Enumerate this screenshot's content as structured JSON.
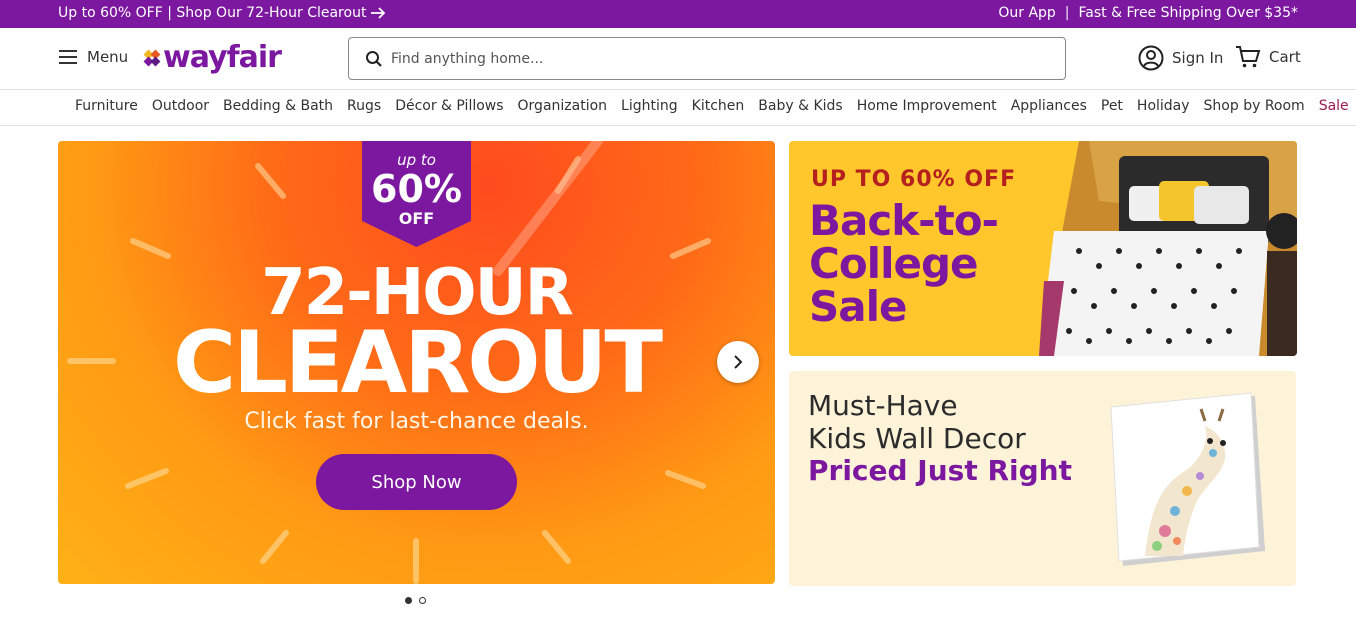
{
  "promo_bar": {
    "left_text": "Up to 60% OFF | Shop Our 72-Hour Clearout",
    "app_link": "Our App",
    "shipping_text": "Fast & Free Shipping Over $35*"
  },
  "header": {
    "menu_label": "Menu",
    "logo_text": "wayfair",
    "search_placeholder": "Find anything home...",
    "signin_label": "Sign In",
    "cart_label": "Cart"
  },
  "categories": [
    "Furniture",
    "Outdoor",
    "Bedding & Bath",
    "Rugs",
    "Décor & Pillows",
    "Organization",
    "Lighting",
    "Kitchen",
    "Baby & Kids",
    "Home Improvement",
    "Appliances",
    "Pet",
    "Holiday",
    "Shop by Room",
    "Sale"
  ],
  "hero": {
    "badge_upto": "up to",
    "badge_percent": "60%",
    "badge_off": "OFF",
    "title_line1": "72-HOUR",
    "title_line2": "CLEAROUT",
    "subtitle": "Click fast for last-chance deals.",
    "cta_label": "Shop Now",
    "slide_count": 2,
    "active_slide": 1
  },
  "promo_cards": [
    {
      "kicker": "UP TO 60% OFF",
      "title_lines": [
        "Back-to-",
        "College",
        "Sale"
      ]
    },
    {
      "line1": "Must-Have",
      "line2": "Kids Wall Decor",
      "line3": "Priced Just Right"
    }
  ],
  "colors": {
    "brand_purple": "#7b189f",
    "sale_red": "#9b1a53",
    "card1_bg": "#ffc72c",
    "card2_bg": "#fdf3d9"
  }
}
